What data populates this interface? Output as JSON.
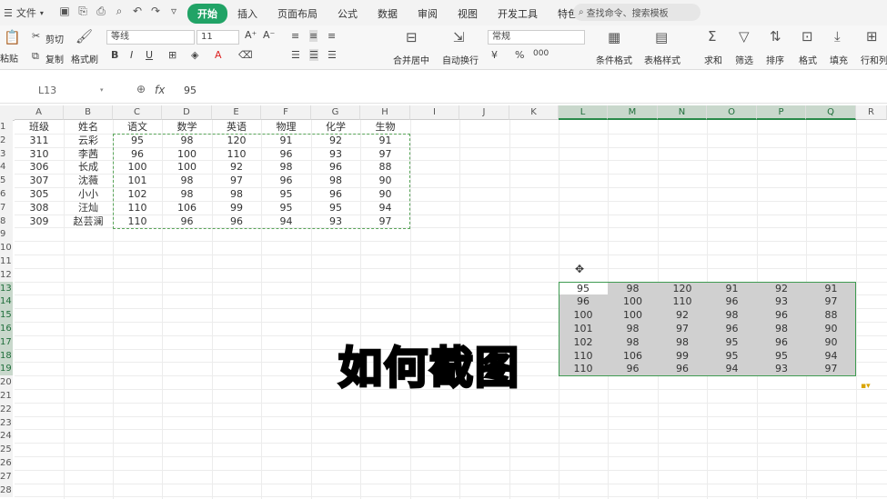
{
  "menu": {
    "file_label": "文件"
  },
  "tabs": [
    "开始",
    "插入",
    "页面布局",
    "公式",
    "数据",
    "审阅",
    "视图",
    "开发工具",
    "特色功能"
  ],
  "active_tab": "开始",
  "search": {
    "placeholder": "查找命令、搜索模板"
  },
  "ribbon": {
    "paste": "粘贴",
    "cut": "剪切",
    "copy": "复制",
    "format_painter": "格式刷",
    "font_name": "等线",
    "font_size": "11",
    "merge_center": "合并居中",
    "wrap_text": "自动换行",
    "number_format": "常规",
    "conditional_format": "条件格式",
    "table_style": "表格样式",
    "sum": "求和",
    "filter": "筛选",
    "sort": "排序",
    "format": "格式",
    "fill": "填充",
    "rows_cols": "行和列"
  },
  "formula_bar": {
    "cell_ref": "L13",
    "fx": "fx",
    "value": "95"
  },
  "columns": [
    "A",
    "B",
    "C",
    "D",
    "E",
    "F",
    "G",
    "H",
    "I",
    "J",
    "K",
    "L",
    "M",
    "N",
    "O",
    "P",
    "Q",
    "R"
  ],
  "rows": [
    "1",
    "2",
    "3",
    "4",
    "5",
    "6",
    "7",
    "8",
    "9",
    "10",
    "11",
    "12",
    "13",
    "14",
    "15",
    "16",
    "17",
    "18",
    "19",
    "20",
    "21",
    "22",
    "23",
    "24",
    "25",
    "26",
    "27",
    "28"
  ],
  "header_row": [
    "班级",
    "姓名",
    "语文",
    "数学",
    "英语",
    "物理",
    "化学",
    "生物"
  ],
  "data_rows": [
    [
      "311",
      "云彩",
      "95",
      "98",
      "120",
      "91",
      "92",
      "91"
    ],
    [
      "310",
      "李茜",
      "96",
      "100",
      "110",
      "96",
      "93",
      "97"
    ],
    [
      "306",
      "长成",
      "100",
      "100",
      "92",
      "98",
      "96",
      "88"
    ],
    [
      "307",
      "沈薇",
      "101",
      "98",
      "97",
      "96",
      "98",
      "90"
    ],
    [
      "305",
      "小小",
      "102",
      "98",
      "98",
      "95",
      "96",
      "90"
    ],
    [
      "308",
      "汪灿",
      "110",
      "106",
      "99",
      "95",
      "95",
      "94"
    ],
    [
      "309",
      "赵芸澜",
      "110",
      "96",
      "96",
      "94",
      "93",
      "97"
    ]
  ],
  "pasted_block": [
    [
      "95",
      "98",
      "120",
      "91",
      "92",
      "91"
    ],
    [
      "96",
      "100",
      "110",
      "96",
      "93",
      "97"
    ],
    [
      "100",
      "100",
      "92",
      "98",
      "96",
      "88"
    ],
    [
      "101",
      "98",
      "97",
      "96",
      "98",
      "90"
    ],
    [
      "102",
      "98",
      "98",
      "95",
      "96",
      "90"
    ],
    [
      "110",
      "106",
      "99",
      "95",
      "95",
      "94"
    ],
    [
      "110",
      "96",
      "96",
      "94",
      "93",
      "97"
    ]
  ],
  "overlay_text": "如何截图",
  "colors": {
    "accent": "#21a366",
    "selection": "#3f9b52",
    "overlay": "#ffe000"
  }
}
